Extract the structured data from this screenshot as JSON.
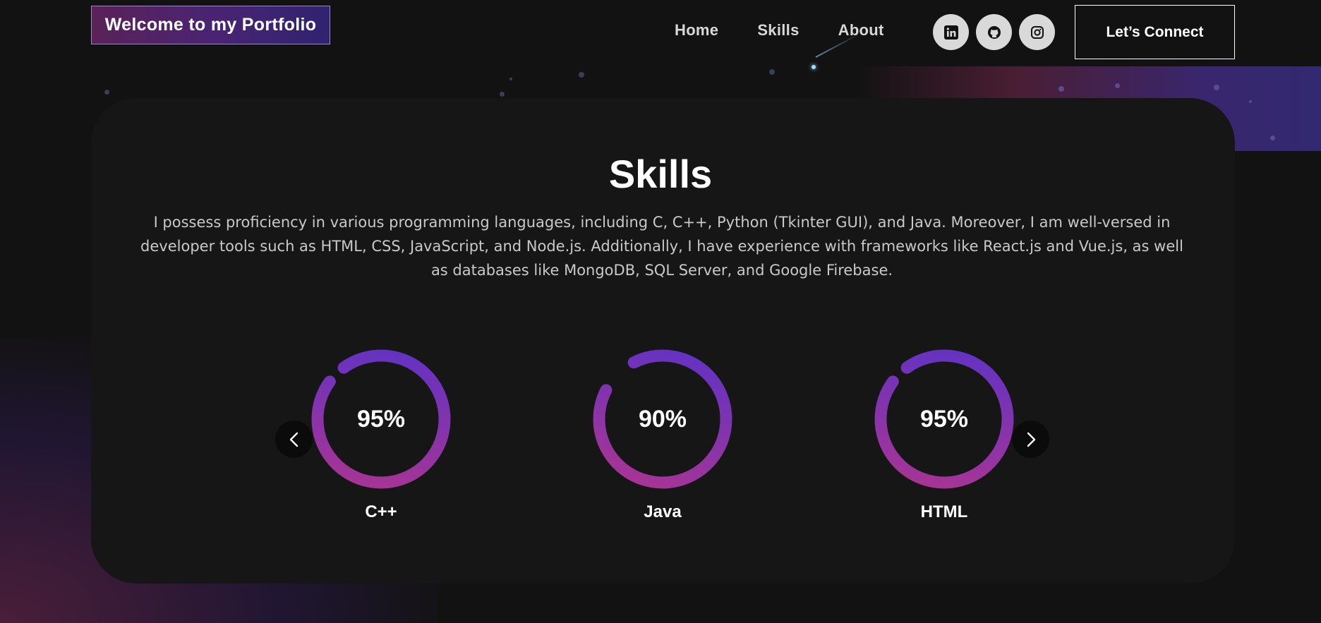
{
  "header": {
    "brand": "Welcome to my Portfolio",
    "nav": [
      "Home",
      "Skills",
      "About"
    ],
    "socials": [
      {
        "name": "linkedin-icon",
        "glyph": "in"
      },
      {
        "name": "github-icon",
        "glyph": "gh"
      },
      {
        "name": "instagram-icon",
        "glyph": "ig"
      }
    ],
    "cta": "Let’s Connect"
  },
  "skills": {
    "title": "Skills",
    "description": "I possess proficiency in various programming languages, including C, C++, Python (Tkinter GUI), and Java. Moreover, I am well-versed in developer tools such as HTML, CSS, JavaScript, and Node.js. Additionally, I have experience with frameworks like React.js and Vue.js, as well as databases like MongoDB, SQL Server, and Google Firebase.",
    "items": [
      {
        "label": "C++",
        "percent_text": "95%",
        "value": 95
      },
      {
        "label": "Java",
        "percent_text": "90%",
        "value": 90
      },
      {
        "label": "HTML",
        "percent_text": "95%",
        "value": 95
      }
    ]
  },
  "colors": {
    "background": "#121212",
    "card": "#161616",
    "ring_start": "#b0348e",
    "ring_end": "#5a33c8"
  }
}
